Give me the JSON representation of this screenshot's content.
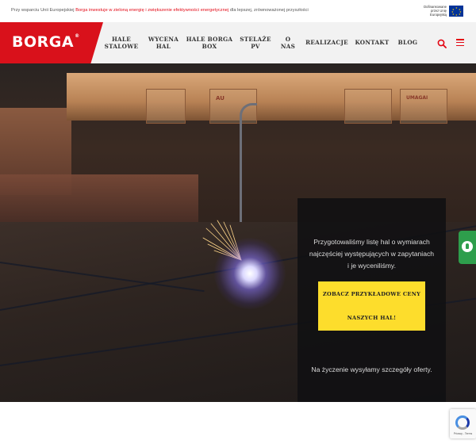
{
  "eu_notice": {
    "prefix": "Przy wsparciu Unii Europejskiej",
    "link": "Borga inwestuje w zieloną energię i zwiększenie efektywności energetycznej",
    "suffix": "dla lepszej, zrównoważonej przyszłości",
    "badge_text": "Dofinansowane przez Unię Europejską"
  },
  "header": {
    "logo": "BORGA",
    "logo_mark": "®",
    "nav": [
      {
        "line1": "HALE",
        "line2": "STALOWE"
      },
      {
        "line1": "WYCENA",
        "line2": "HAL"
      },
      {
        "line1": "HALE BORGA",
        "line2": "BOX"
      },
      {
        "line1": "STELAŻE",
        "line2": "PV"
      },
      {
        "line1": "O",
        "line2": "NAS"
      },
      {
        "line1": "REALIZACJE",
        "line2": ""
      },
      {
        "line1": "KONTAKT",
        "line2": ""
      },
      {
        "line1": "BLOG",
        "line2": ""
      }
    ],
    "search_icon": "search-icon",
    "menu_icon": "hamburger-menu-icon"
  },
  "hero": {
    "photo_labels": [
      "AU",
      "UMAGAI"
    ],
    "card_text": "Przygotowaliśmy listę hal o wymiarach najczęściej występujących w zapytaniach i je wyceniliśmy.",
    "button_line1": "ZOBACZ PRZYKŁADOWE CENY",
    "button_line2": "NASZYCH HAL!",
    "card_note": "Na życzenie wysyłamy szczegóły oferty."
  },
  "side": {
    "eco_icon": "lightbulb-eco-icon"
  },
  "recaptcha": {
    "label": "Privacy - Terms"
  },
  "colors": {
    "brand_red": "#d9111b",
    "cta_yellow": "#fddd2c",
    "eco_green": "#2e9e4c",
    "eu_blue": "#003399"
  }
}
